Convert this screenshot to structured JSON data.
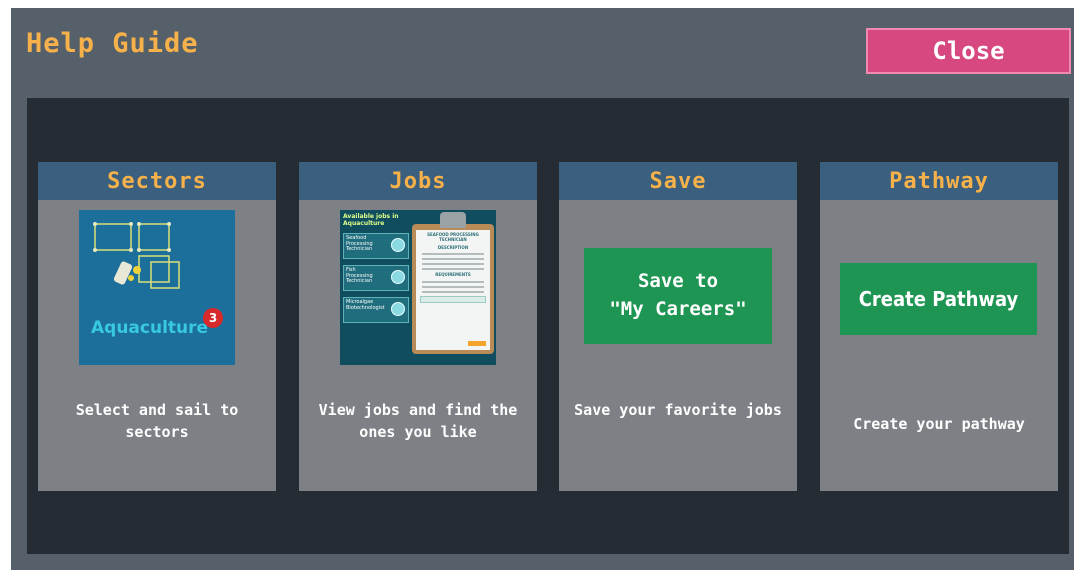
{
  "header": {
    "title": "Help Guide",
    "close_label": "Close"
  },
  "colors": {
    "accent_text": "#f7b14a",
    "close_button": "#d6487f",
    "card_header": "#3b5f7e",
    "card_body": "#7d8186",
    "action_green": "#1e9553",
    "panel": "#262c34"
  },
  "cards": [
    {
      "title": "Sectors",
      "description": "Select and sail to sectors",
      "image": {
        "sector_name": "Aquaculture",
        "badge_count": "3"
      }
    },
    {
      "title": "Jobs",
      "description": "View jobs and find the ones you like",
      "image": {
        "list_header": "Available jobs in Aquaculture",
        "list_items": [
          "Seafood Processing Technician",
          "Fish Processing Technician",
          "Microalgae Biotechnologist"
        ],
        "clipboard_title": "SEAFOOD PROCESSING TECHNICIAN",
        "section_description": "DESCRIPTION",
        "section_requirements": "REQUIREMENTS"
      }
    },
    {
      "title": "Save",
      "description": "Save your favorite jobs",
      "button_line1": "Save to",
      "button_line2": "\"My Careers\""
    },
    {
      "title": "Pathway",
      "description": "Create your pathway",
      "button_label": "Create Pathway"
    }
  ]
}
